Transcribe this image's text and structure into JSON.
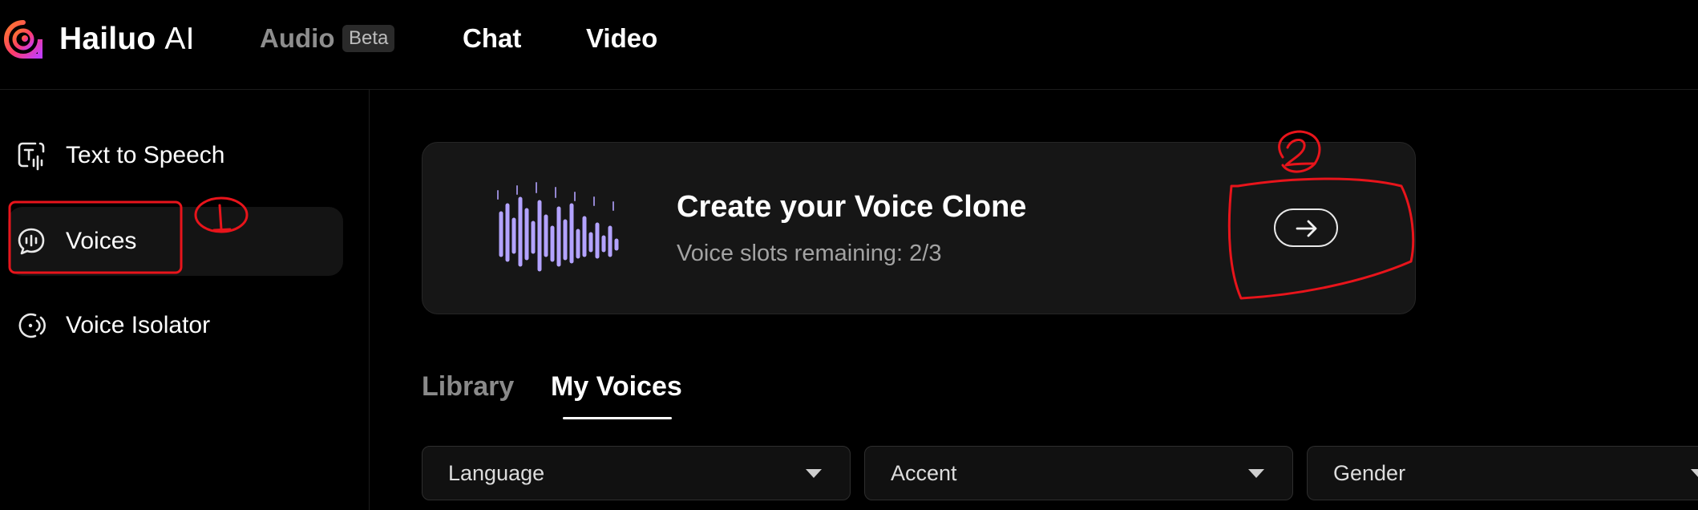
{
  "brand": {
    "name": "Hailuo",
    "suffix": "AI"
  },
  "nav": {
    "audio": "Audio",
    "audio_badge": "Beta",
    "chat": "Chat",
    "video": "Video"
  },
  "sidebar": {
    "items": [
      {
        "label": "Text to Speech",
        "icon": "text-to-speech-icon",
        "active": false
      },
      {
        "label": "Voices",
        "icon": "voices-icon",
        "active": true
      },
      {
        "label": "Voice Isolator",
        "icon": "voice-isolator-icon",
        "active": false
      }
    ]
  },
  "clone_card": {
    "title": "Create your Voice Clone",
    "subtitle": "Voice slots remaining: 2/3",
    "action_icon": "arrow-right-icon"
  },
  "tabs": [
    {
      "label": "Library",
      "active": false
    },
    {
      "label": "My Voices",
      "active": true
    }
  ],
  "filters": [
    {
      "label": "Language"
    },
    {
      "label": "Accent"
    },
    {
      "label": "Gender"
    }
  ],
  "annotations": {
    "mark_1": "1",
    "mark_2": "2"
  },
  "colors": {
    "accent_wave": "#b3a3ff",
    "annotation": "#e8141b",
    "background": "#000000"
  }
}
